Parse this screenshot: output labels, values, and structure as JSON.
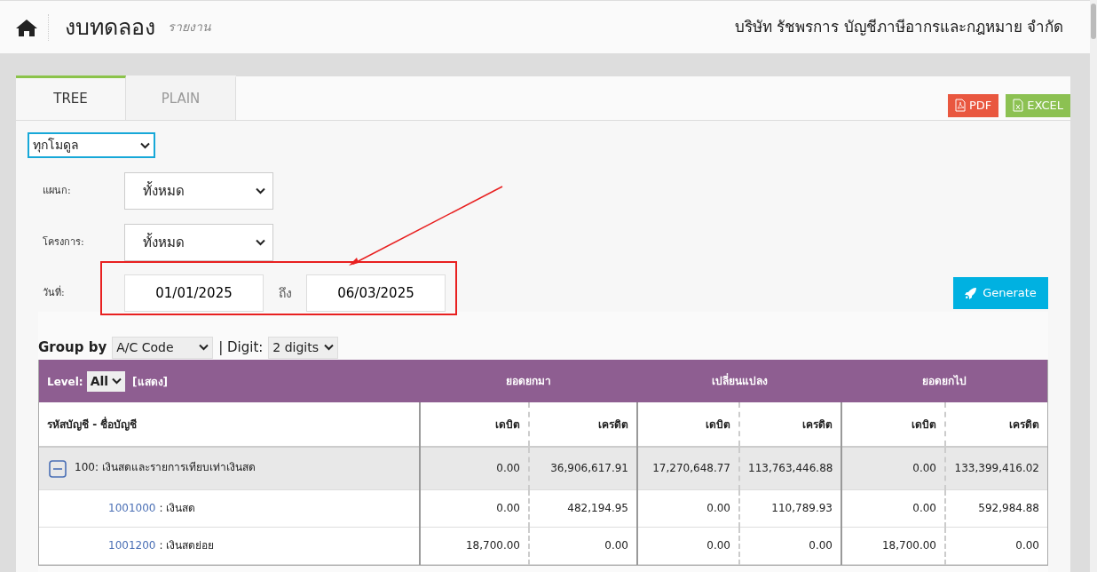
{
  "header": {
    "title": "งบทดลอง",
    "subtitle": "รายงาน",
    "company": "บริษัท รัชพรการ บัญชีภาษีอากรและกฎหมาย จำกัด"
  },
  "tabs": [
    {
      "label": "TREE",
      "selected": true
    },
    {
      "label": "PLAIN",
      "selected": false
    }
  ],
  "export_buttons": [
    {
      "kind": "pdf",
      "label": "PDF"
    },
    {
      "kind": "excel",
      "label": "EXCEL"
    }
  ],
  "module_select": {
    "value": "ทุกโมดูล"
  },
  "filters": [
    {
      "label": "แผนก:",
      "value": "ทั้งหมด"
    },
    {
      "label": "โครงการ:",
      "value": "ทั้งหมด"
    }
  ],
  "date_range": {
    "label": "วันที่:",
    "from": "01/01/2025",
    "separator": "ถึง",
    "to": "06/03/2025",
    "highlighted": true
  },
  "generate_button": "Generate",
  "group_by": {
    "label": "Group by",
    "value": "A/C Code",
    "digit_label": "| Digit:",
    "digit_value": "2 digits"
  },
  "table": {
    "level_label": "Level:",
    "level_value": "All",
    "show_link": "[แสดง]",
    "groups": [
      "ยอดยกมา",
      "เปลี่ยนแปลง",
      "ยอดยกไป"
    ],
    "columns": [
      "รหัสบัญชี - ชื่อบัญชี",
      "เดบิต",
      "เครดิต",
      "เดบิต",
      "เครดิต",
      "เดบิต",
      "เครดิต"
    ],
    "rows": [
      {
        "kind": "group",
        "expanded": true,
        "label": "100: เงินสดและรายการเทียบเท่าเงินสด",
        "values": [
          "0.00",
          "36,906,617.91",
          "17,270,648.77",
          "113,763,446.88",
          "0.00",
          "133,399,416.02"
        ]
      },
      {
        "kind": "account",
        "code": "1001000",
        "name": ": เงินสด",
        "values": [
          "0.00",
          "482,194.95",
          "0.00",
          "110,789.93",
          "0.00",
          "592,984.88"
        ]
      },
      {
        "kind": "account",
        "code": "1001200",
        "name": ": เงินสดย่อย",
        "values": [
          "18,700.00",
          "0.00",
          "0.00",
          "0.00",
          "18,700.00",
          "0.00"
        ]
      }
    ]
  }
}
